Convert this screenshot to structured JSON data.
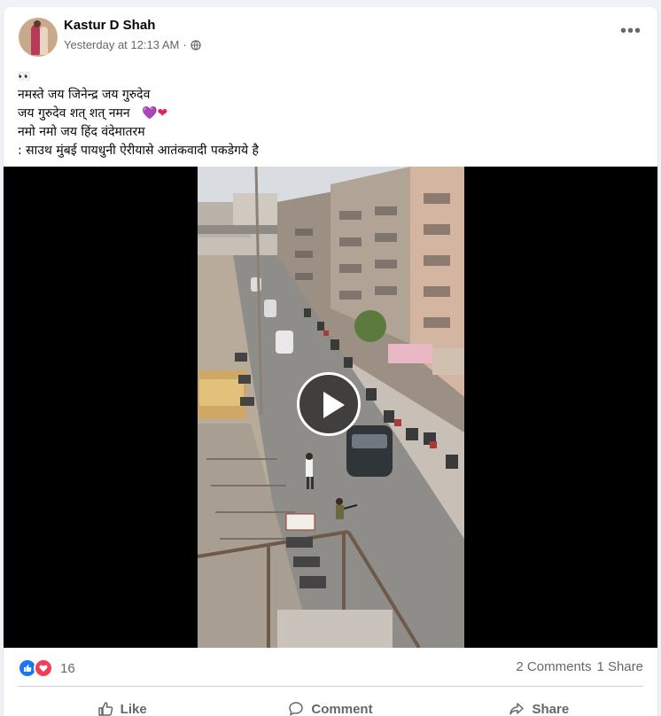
{
  "post": {
    "author": "Kastur D Shah",
    "timestamp": "Yesterday at 12:13 AM",
    "separator": "·",
    "privacy_icon": "globe-icon",
    "more_label": "•••",
    "lines": [
      "👀",
      "नमस्ते जय जिनेन्द्र जय गुरुदेव",
      "जय गुरुदेव शत् शत् नमन",
      "नमो नमो जय हिंद वंदेमातरम",
      ": साउथ मुंबई पायधुनी ऐरीयासे आतंकवादी पकडेगये है"
    ],
    "hearts": [
      "💜",
      "❤"
    ]
  },
  "video": {
    "play_icon": "play-icon"
  },
  "stats": {
    "reaction_count": "16",
    "comments": "2 Comments",
    "shares": "1 Share"
  },
  "actions": {
    "like": "Like",
    "comment": "Comment",
    "share": "Share"
  },
  "colors": {
    "like_blue": "#1877f2",
    "love_red": "#f33e58",
    "meta_gray": "#65676b"
  }
}
